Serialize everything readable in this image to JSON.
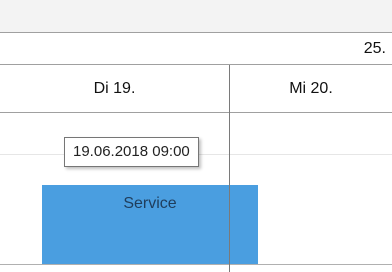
{
  "calendar": {
    "week_label": "25.",
    "days": [
      {
        "label": "Di 19."
      },
      {
        "label": "Mi 20."
      }
    ],
    "tooltip_text": "19.06.2018 09:00",
    "appointment": {
      "title": "Service",
      "color": "#4a9ee0"
    }
  }
}
